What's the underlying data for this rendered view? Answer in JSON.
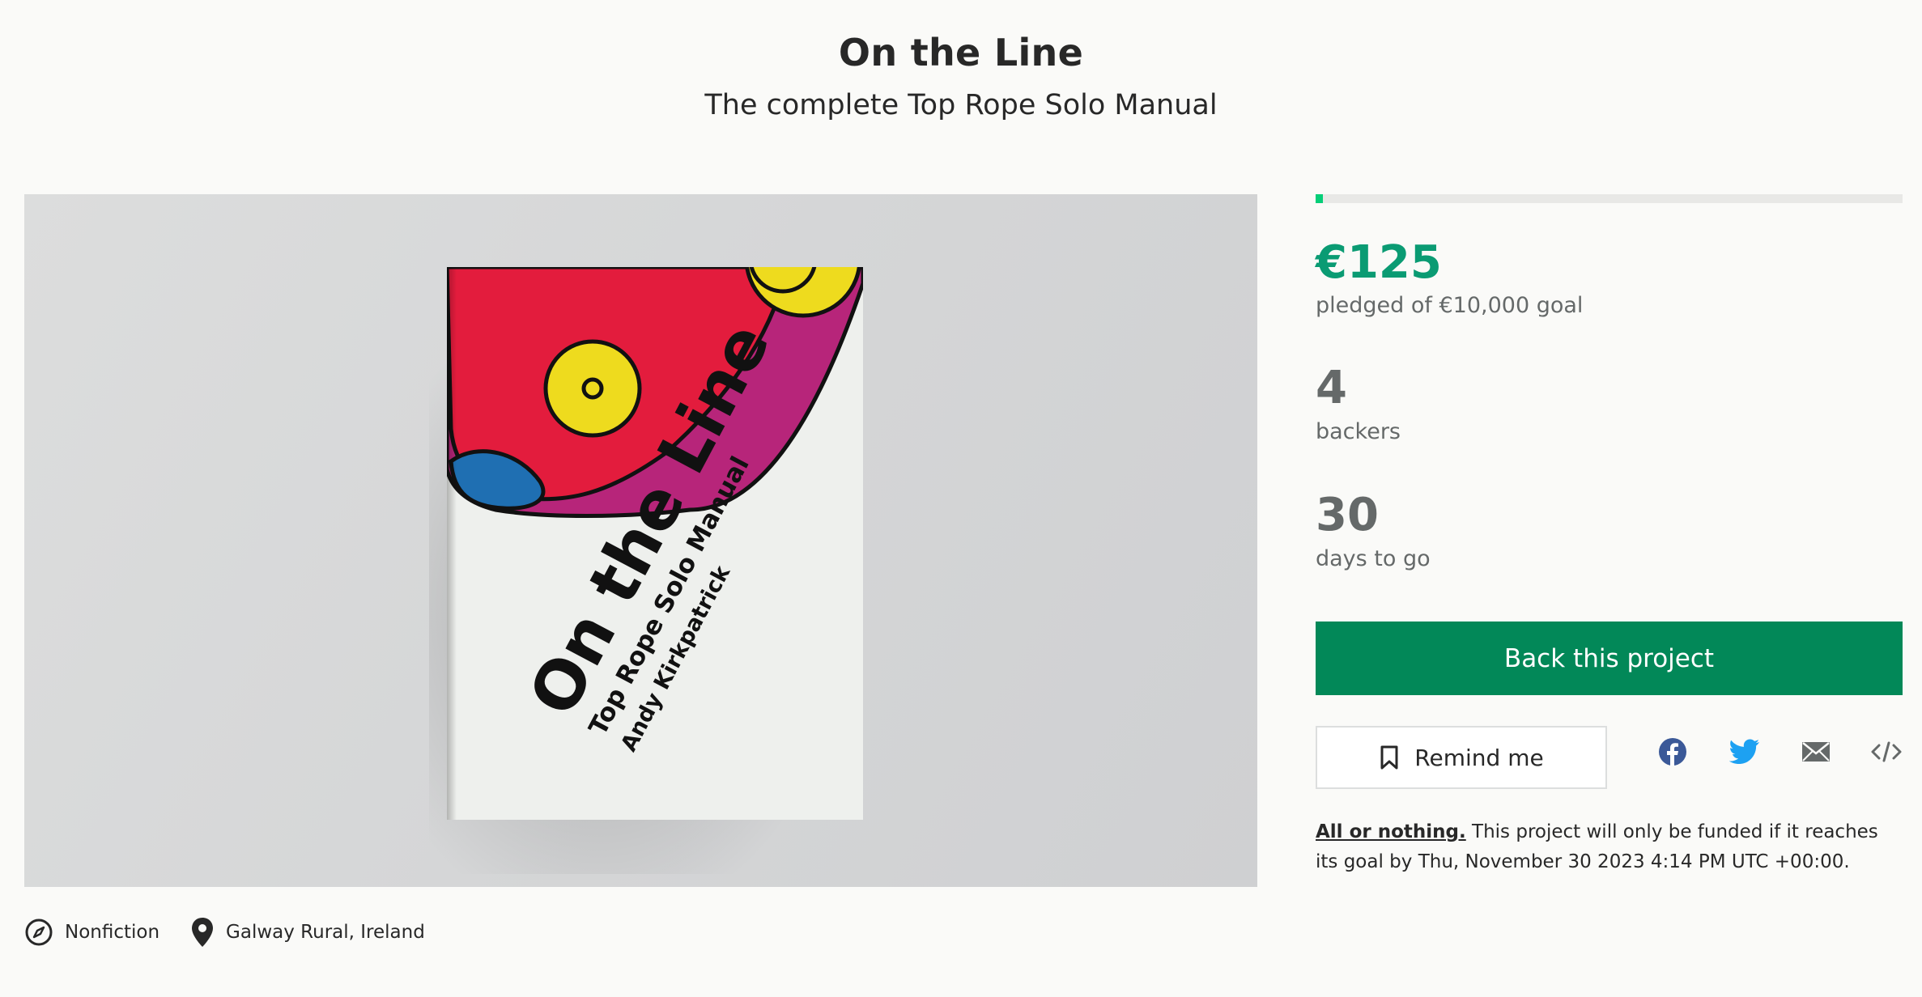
{
  "project": {
    "title": "On the Line",
    "subtitle": "The complete Top Rope Solo Manual"
  },
  "cover": {
    "title": "On the Line",
    "subtitle": "Top Rope Solo Manual",
    "author": "Andy Kirkpatrick",
    "colors": {
      "red": "#e31c3d",
      "magenta": "#b7257a",
      "yellow": "#eedb1e",
      "blue": "#1f6fb2",
      "paper": "#eef0ed"
    }
  },
  "meta": {
    "category": {
      "label": "Nonfiction",
      "icon": "compass-icon"
    },
    "location": {
      "label": "Galway Rural, Ireland",
      "icon": "location-pin-icon"
    }
  },
  "funding": {
    "progress_fraction": 0.0125,
    "pledged": "€125",
    "pledged_label": "pledged of €10,000 goal",
    "backers": "4",
    "backers_label": "backers",
    "days": "30",
    "days_label": "days to go"
  },
  "actions": {
    "back_label": "Back this project",
    "remind_label": "Remind me"
  },
  "share": [
    {
      "name": "facebook-icon",
      "color": "#3b5998"
    },
    {
      "name": "twitter-icon",
      "color": "#1da1f2"
    },
    {
      "name": "email-icon",
      "color": "#656969"
    },
    {
      "name": "embed-icon",
      "color": "#656969"
    }
  ],
  "notice": {
    "link": "All or nothing.",
    "text": " This project will only be funded if it reaches its goal by Thu, November 30 2023 4:14 PM UTC +00:00."
  },
  "colors": {
    "accent": "#028858",
    "pledged": "#0a9b73",
    "progress": "#05ce78"
  }
}
